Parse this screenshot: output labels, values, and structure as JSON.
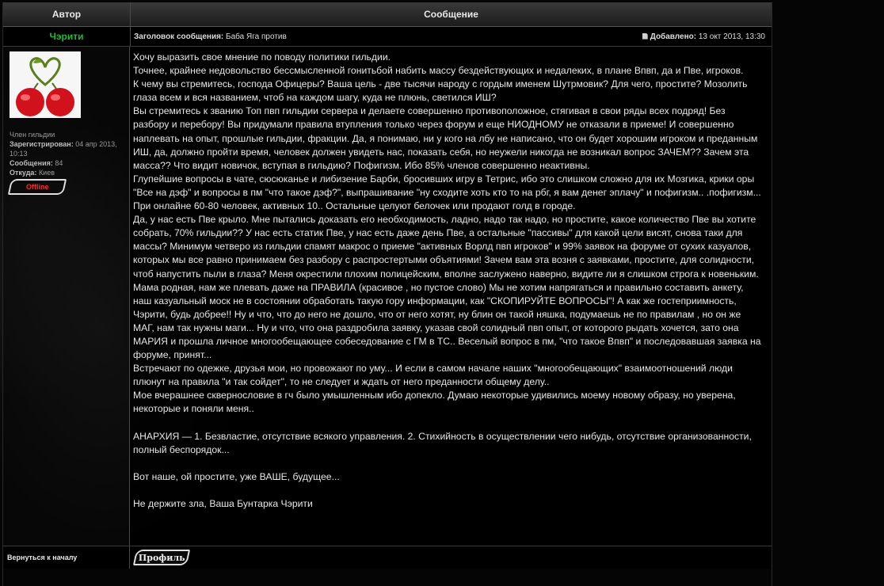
{
  "header": {
    "author_col": "Автор",
    "message_col": "Сообщение"
  },
  "post": {
    "author": "Чэрити",
    "subject_label": "Заголовок сообщения:",
    "subject": "Баба Яга против",
    "added_label": "Добавлено:",
    "added_date": "13 окт 2013, 13:30",
    "profile": {
      "rank": "Член гильдии",
      "registered_label": "Зарегистрирован:",
      "registered": "04 апр 2013, 10:13",
      "posts_label": "Сообщения:",
      "posts": "84",
      "from_label": "Откуда:",
      "from": "Киев",
      "status": "Offline"
    },
    "body": [
      "Хочу выразить свое мнение по поводу политики гильдии.",
      "Точнее, крайнее недовольство бессмысленной гонитьбой набить массу бездействующих и недалеких, в плане Впвп, да и Пве, игроков.",
      "К чему вы стремитесь, господа Офицеры? Ваша цель - две тысячи народу с гордым именем Шутрмовик? Для чего, простите? Мозолить глаза всем и вся названием, чтоб на каждом шагу, куда не плюнь, светился ИШ?",
      "Вы стремитесь к званию Топ пвп гильдии сервера и делаете совершенно противоположное, стягивая в свои ряды всех подряд! Без разбору и перебору! Вы придумали правила втупления только через форум и еще НИОДНОМУ не отказали в приеме! И совершенно наплевать на опыт, прошлые гильдии, фракции. Да, я понимаю, ни у кого на лбу не написано, что он будет хорошим игроком и преданным ИШ, да, должно пройти время, человек должен увидеть нас, показать себя, но неужели никогда не возникал вопрос ЗАЧЕМ?? Зачем эта масса?? Что видит новичок, вступая в гильдию? Пофигизм. Ибо 85% членов совершенно неактивны.",
      "Глупейшие вопросы в чате, сюсюканье и либизение Барби, бросивших игру в Тетрис, ибо это слишком сложно для их Мозгика, крики оры \"Все на дэф\" и вопросы в пм \"что такое дэф?\", выпрашивание \"ну сходите хоть кто то на рбг, я вам денег эплачу\" и пофигизм.. .пофигизм... При онлайне 60-80 человек, активных 10.. Остальные целуют белочек или продают голд в городе.",
      "Да, у нас есть Пве крыло. Мне пытались доказать его необходимость, ладно, надо так надо, но простите, какое количество Пве вы хотите собрать, 70% гильдии?? У нас есть статик Пве, у нас есть даже день Пве, а остальные \"пассивы\" для какой цели висят, снова таки для массы? Минимум четверо из гильдии спамят макрос о приеме \"активных Ворлд пвп игроков\" и 99% заявок на форуме от сухих казуалов, которых мы все равно принимаем без разбору с распростертыми объятиями! Зачем вам эта возня с заявками, простите, для солидности, чтоб напустить пыли в глаза? Меня окрестили плохим полицейским, вполне заслужено наверно, видите ли я слишком строга к новеньким. Мама родная, нам же плевать даже на ПРАВИЛА (красивое , но пустое слово) Мы не хотим напрягаться и правильно составить анкету, наш казуальный моск не в состоянии обработать такую гору информации, как \"СКОПИРУЙТЕ ВОПРОСЫ\"! А как же гостеприимность, Чэрити, будь добрее!! Ну и что, что до него не дошло, что от него хотят, ну блин он такой няшка, подумаешь не по правилам , но он же МАГ, нам так нужны маги... Ну и что, что она раздробила заявку, указав свой солидный пвп опыт, от которого рыдать хочется, зато она МАРИЯ и прошла личное многообещающее собеседование с ГМ в ТС.. Веселый вопрос в пм, \"что такое Впвп\" и последовавшая заявка на форуме, принят...",
      "Встречают по одежке, друзья мои, но провожают по уму... И если в самом начале наших \"многообещающих\" взаимоотношений люди плюнут на правила \"и так сойдет\", то не следует и ждать от него преданности общему делу..",
      "Мое вчерашнее сквернословие в гч было умышленным ибо допекло. Думаю некоторые удивились моему новому образу, но уверена, некоторые и поняли меня..",
      "",
      "АНАРХИЯ — 1. Безвластие, отсутствие всякого управления. 2. Стихийность в осуществлении чего нибудь, отсутствие организованности, полный беспорядок...",
      "",
      "Вот наше, ой простите, уже ВАШЕ, будущее...",
      "",
      "Не держите зла, Ваша Бунтарка Чэрити"
    ]
  },
  "footer": {
    "back_to_top": "Вернуться к началу",
    "profile_button": "Профиль"
  },
  "colors": {
    "author_name": "#22b83a",
    "offline": "#ff2a2a"
  }
}
